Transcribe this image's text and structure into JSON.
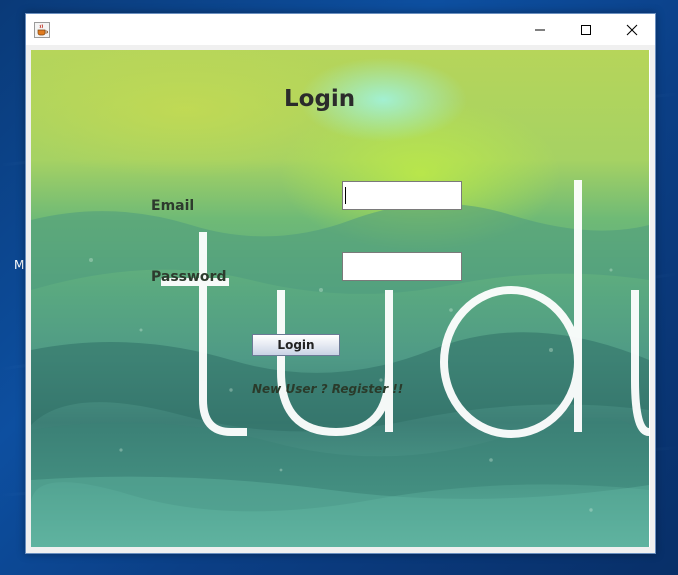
{
  "desktop": {
    "edge_letter": "M"
  },
  "window": {
    "title": "",
    "icon": "java-cup-icon",
    "controls": {
      "minimize_icon": "minimize-icon",
      "maximize_icon": "maximize-icon",
      "close_icon": "close-icon"
    }
  },
  "login_form": {
    "heading": "Login",
    "email_label": "Email",
    "email_value": "",
    "password_label": "Password",
    "password_value": "",
    "submit_label": "Login",
    "register_link": "New User ? Register !!"
  },
  "background": {
    "logo_text": "tudu",
    "colors": {
      "top": "#b6d55a",
      "middle": "#5aa980",
      "bottom": "#3d7f76"
    }
  }
}
